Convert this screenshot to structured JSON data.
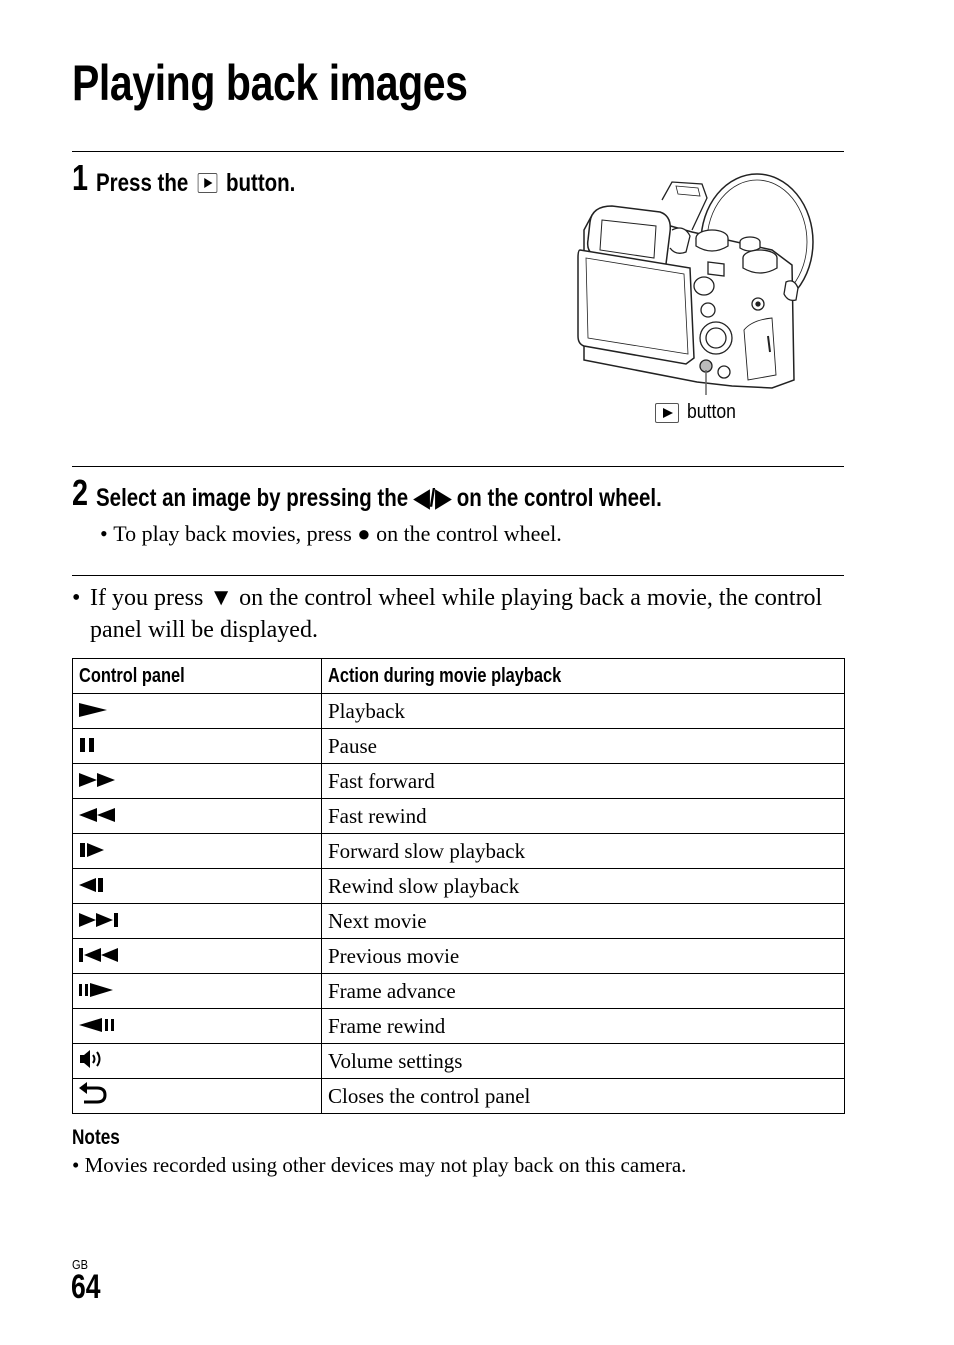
{
  "page": {
    "title": "Playing back images",
    "region_label": "GB",
    "page_number": "64"
  },
  "step1": {
    "number": "1",
    "text_before": "Press the",
    "icon": "playback-button-icon",
    "text_after": "button.",
    "figure_caption": "button",
    "figure_caption_icon": "playback-button-icon"
  },
  "step2": {
    "number": "2",
    "text": "Select an image by pressing the ◀/▶ on the control wheel.",
    "sub_bullet": "To play back movies, press ● on the control wheel."
  },
  "info_bullet": "If you press ▼ on the control wheel while playing back a movie, the control panel will be displayed.",
  "control_table": {
    "headers": [
      "Control panel",
      "Action during movie playback"
    ],
    "rows": [
      {
        "icon": "play-icon",
        "action": "Playback"
      },
      {
        "icon": "pause-icon",
        "action": "Pause"
      },
      {
        "icon": "fast-forward-icon",
        "action": "Fast forward"
      },
      {
        "icon": "fast-rewind-icon",
        "action": "Fast rewind"
      },
      {
        "icon": "forward-slow-icon",
        "action": "Forward slow playback"
      },
      {
        "icon": "rewind-slow-icon",
        "action": "Rewind slow playback"
      },
      {
        "icon": "next-movie-icon",
        "action": "Next movie"
      },
      {
        "icon": "previous-movie-icon",
        "action": "Previous movie"
      },
      {
        "icon": "frame-advance-icon",
        "action": "Frame advance"
      },
      {
        "icon": "frame-rewind-icon",
        "action": "Frame rewind"
      },
      {
        "icon": "volume-icon",
        "action": "Volume settings"
      },
      {
        "icon": "return-icon",
        "action": "Closes the control panel"
      }
    ]
  },
  "notes": {
    "title": "Notes",
    "items": [
      "Movies recorded using other devices may not play back on this camera."
    ]
  }
}
